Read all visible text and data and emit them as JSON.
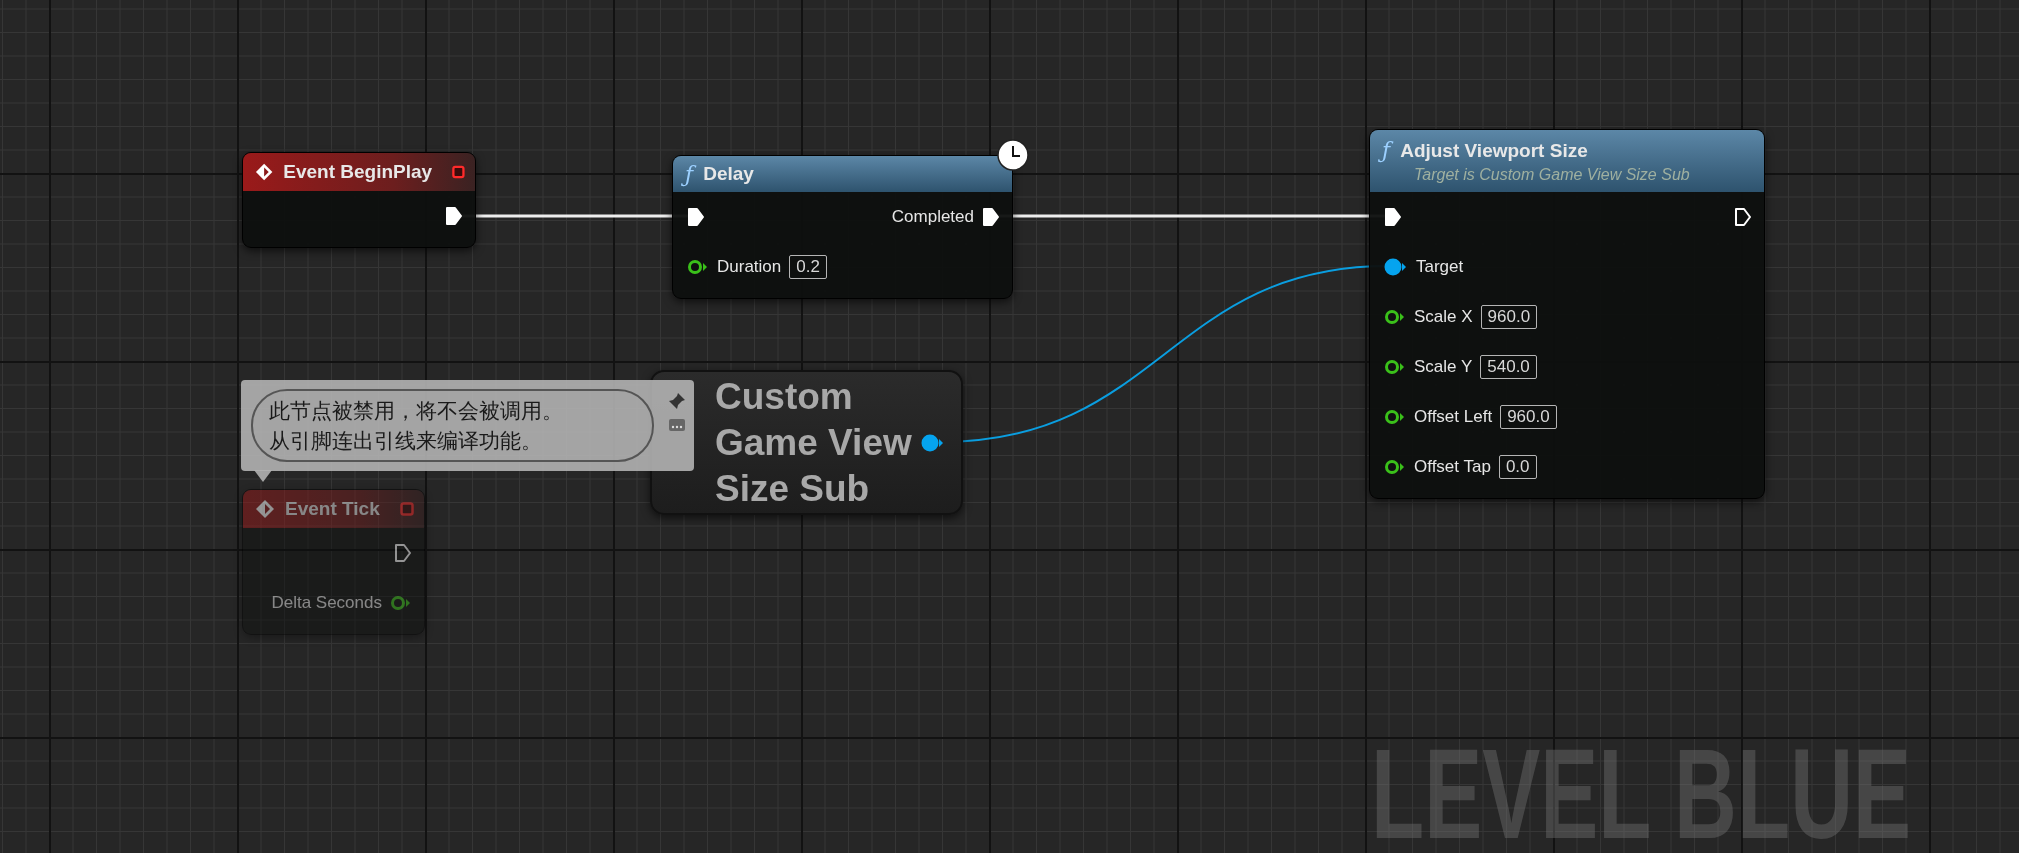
{
  "graph": {
    "nodes": [
      {
        "kind": "event",
        "title": "Event BeginPlay",
        "disabled": false,
        "outputs": [
          {
            "kind": "exec",
            "connected": true
          }
        ]
      },
      {
        "kind": "function",
        "glyph": "ƒ",
        "title": "Delay",
        "latent": true,
        "disabled": false,
        "inputs": [
          {
            "kind": "exec",
            "connected": true
          },
          {
            "kind": "float",
            "label": "Duration",
            "value": "0.2",
            "connected": false
          }
        ],
        "outputs": [
          {
            "kind": "exec",
            "label": "Completed",
            "connected": true
          }
        ]
      },
      {
        "kind": "function",
        "glyph": "ƒ",
        "title": "Adjust Viewport Size",
        "subtitle": "Target is Custom Game View Size Sub",
        "latent": false,
        "disabled": false,
        "inputs": [
          {
            "kind": "exec",
            "connected": true
          },
          {
            "kind": "object",
            "label": "Target",
            "connected": true
          },
          {
            "kind": "float",
            "label": "Scale X",
            "value": "960.0",
            "connected": false
          },
          {
            "kind": "float",
            "label": "Scale Y",
            "value": "540.0",
            "connected": false
          },
          {
            "kind": "float",
            "label": "Offset Left",
            "value": "960.0",
            "connected": false
          },
          {
            "kind": "float",
            "label": "Offset Tap",
            "value": "0.0",
            "connected": false
          }
        ],
        "outputs": [
          {
            "kind": "exec",
            "connected": false
          }
        ]
      },
      {
        "kind": "event",
        "title": "Event Tick",
        "disabled": true,
        "comment_lines": [
          "此节点被禁用，将不会被调用。",
          "从引脚连出引线来编译功能。"
        ],
        "outputs": [
          {
            "kind": "exec",
            "connected": false
          },
          {
            "kind": "float",
            "label": "Delta Seconds",
            "connected": false
          }
        ]
      },
      {
        "kind": "variable",
        "title": "Custom Game View Size Sub",
        "disabled": false,
        "outputs": [
          {
            "kind": "object",
            "connected": true
          }
        ]
      }
    ]
  },
  "graph_label": "LEVEL BLUE"
}
